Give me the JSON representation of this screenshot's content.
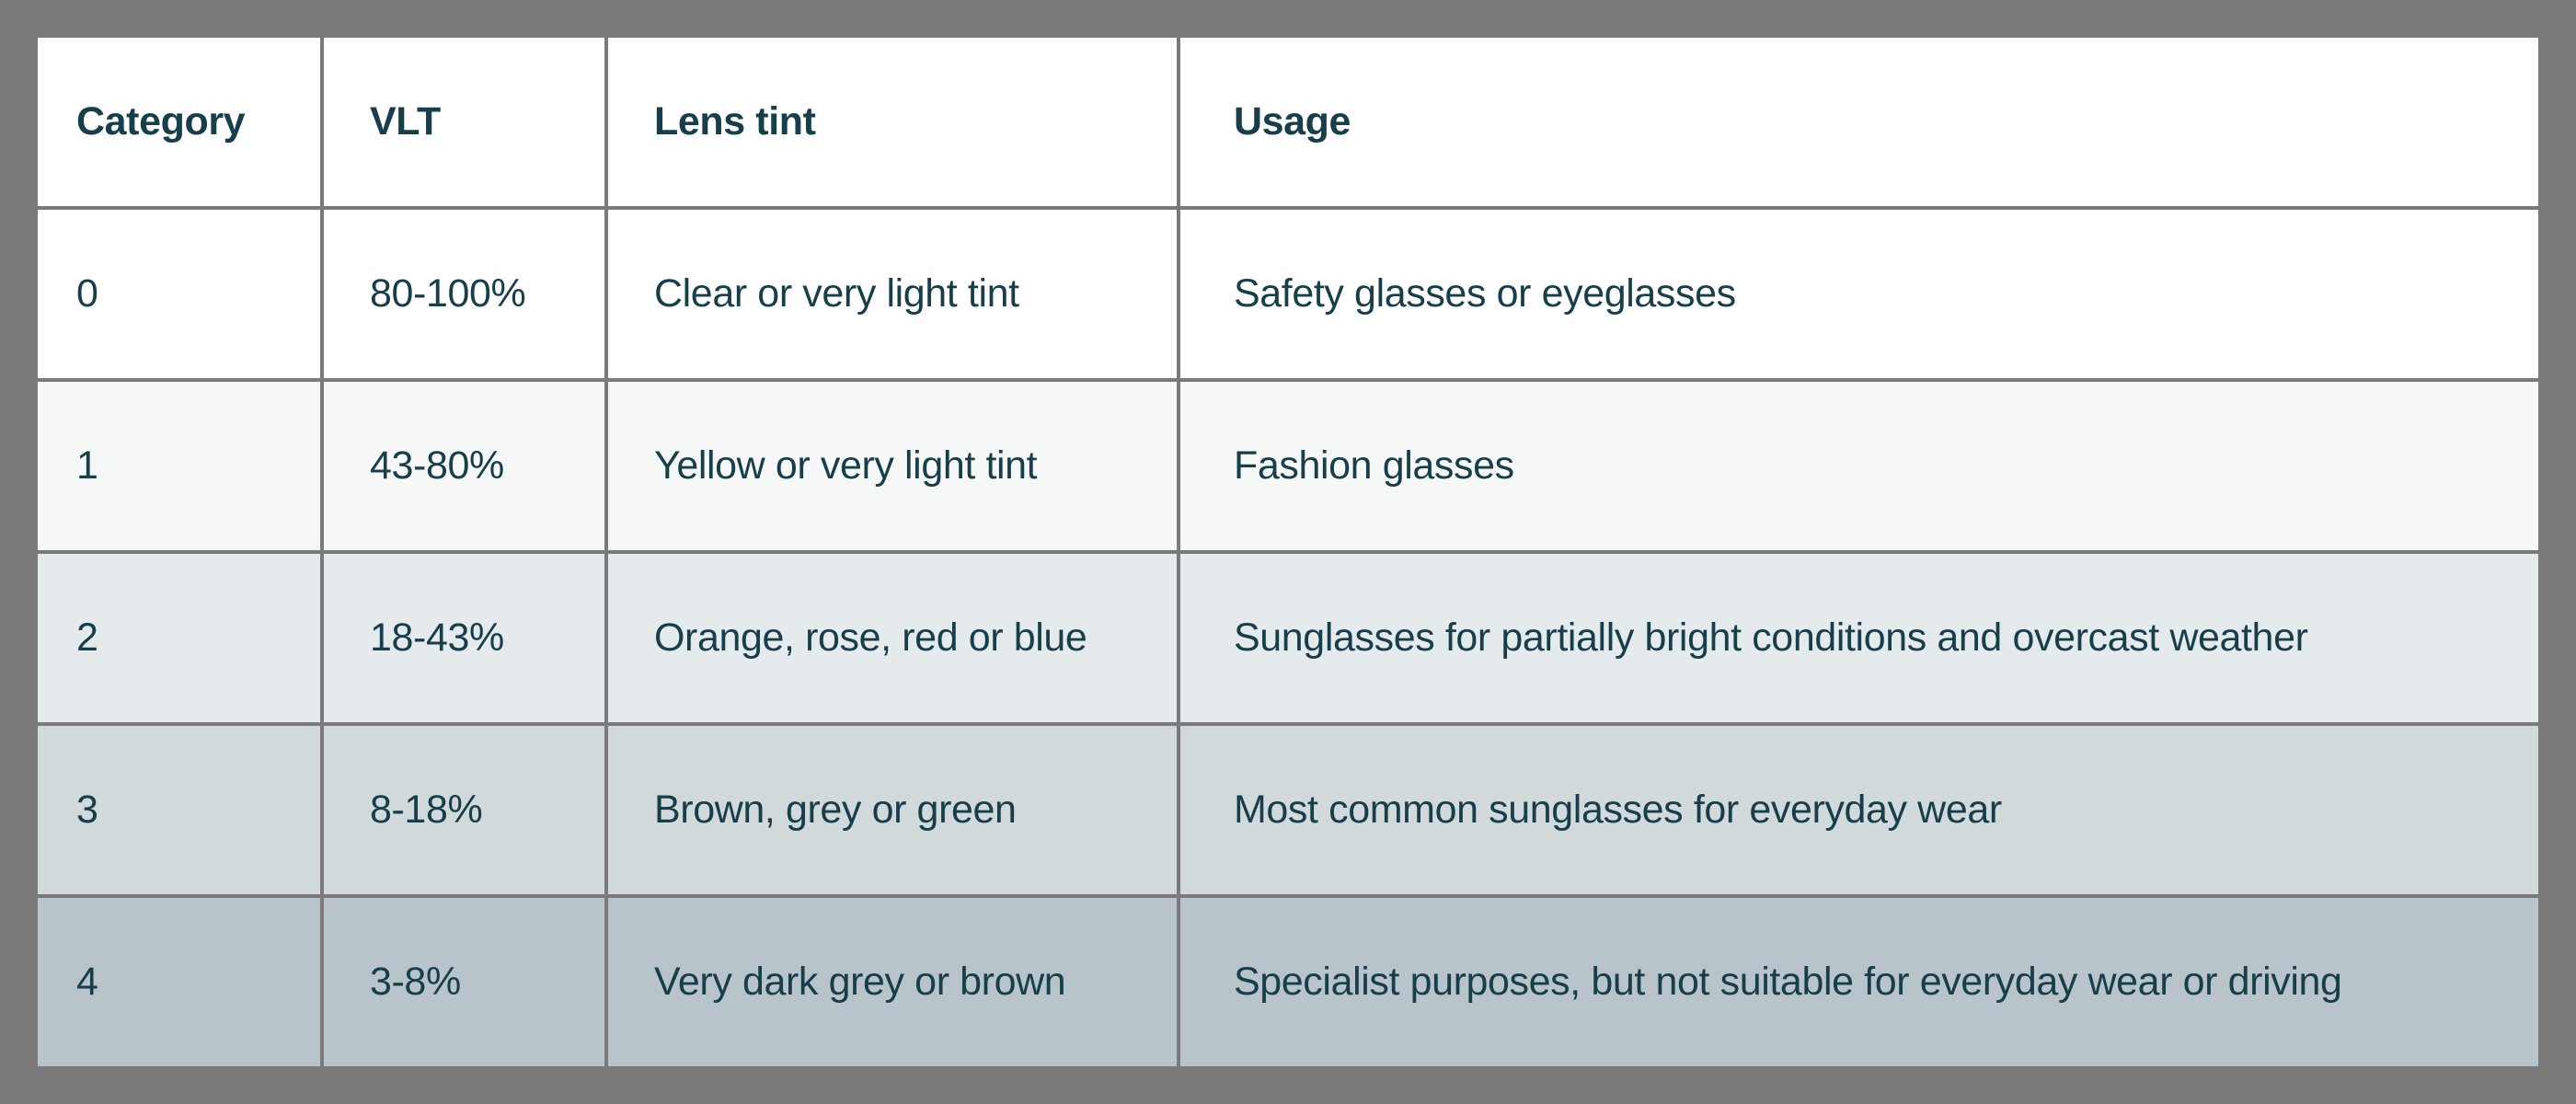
{
  "table": {
    "headers": [
      "Category",
      "VLT",
      "Lens tint",
      "Usage"
    ],
    "rows": [
      [
        "0",
        "80-100%",
        "Clear or very light tint",
        "Safety glasses or eyeglasses"
      ],
      [
        "1",
        "43-80%",
        "Yellow or very light tint",
        "Fashion glasses"
      ],
      [
        "2",
        "18-43%",
        "Orange, rose, red or blue",
        "Sunglasses for partially bright conditions and overcast weather"
      ],
      [
        "3",
        "8-18%",
        "Brown, grey or green",
        "Most common sunglasses for everyday wear"
      ],
      [
        "4",
        "3-8%",
        "Very dark grey or brown",
        "Specialist purposes, but not suitable for everyday wear or driving"
      ]
    ]
  },
  "colors": {
    "text": "#173e4b",
    "border": "#7a7a7a",
    "row_backgrounds": [
      "#ffffff",
      "#f6f8f8",
      "#e5eaed",
      "#d1d9db",
      "#b8c4c9"
    ]
  }
}
